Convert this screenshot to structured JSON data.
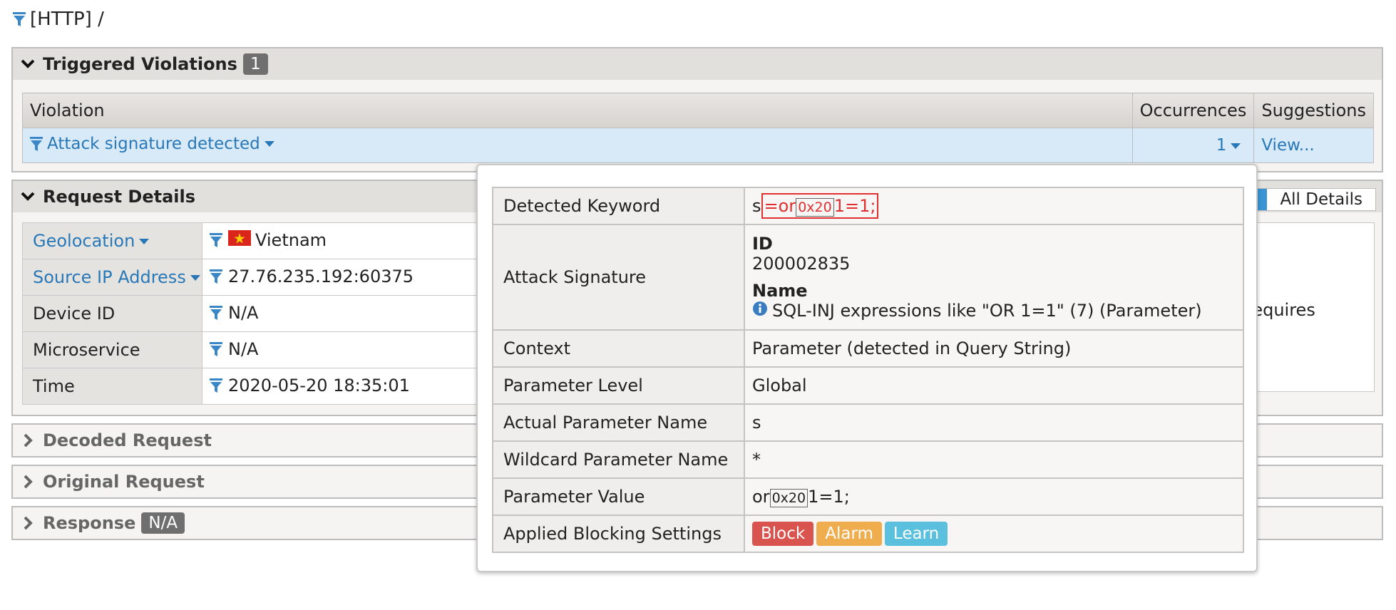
{
  "breadcrumb": {
    "text": "[HTTP] /"
  },
  "violations": {
    "title": "Triggered Violations",
    "count": "1",
    "headers": {
      "violation": "Violation",
      "occurrences": "Occurrences",
      "suggestions": "Suggestions"
    },
    "row": {
      "name": "Attack signature detected",
      "occurrences": "1",
      "suggestion": "View..."
    }
  },
  "request_details": {
    "title": "Request Details",
    "all_details_label": "All Details",
    "partial_text": "requires",
    "rows": [
      {
        "key": "Geolocation",
        "value": "Vietnam"
      },
      {
        "key": "Source IP Address",
        "value": "27.76.235.192:60375"
      },
      {
        "key": "Device ID",
        "value": "N/A"
      },
      {
        "key": "Microservice",
        "value": "N/A"
      },
      {
        "key": "Time",
        "value": "2020-05-20 18:35:01"
      }
    ]
  },
  "collapsed_sections": {
    "decoded": "Decoded Request",
    "original": "Original Request",
    "response": "Response",
    "response_badge": "N/A"
  },
  "popup": {
    "detected_keyword": {
      "label": "Detected Keyword",
      "prefix": "s",
      "hl_a": "=or",
      "hl_hex": "0x20",
      "hl_b": "1=1;"
    },
    "attack_signature": {
      "label": "Attack Signature",
      "id_label": "ID",
      "id": "200002835",
      "name_label": "Name",
      "name": "SQL-INJ expressions like \"OR 1=1\" (7) (Parameter)"
    },
    "context": {
      "label": "Context",
      "value": "Parameter (detected in Query String)"
    },
    "parameter_level": {
      "label": "Parameter Level",
      "value": "Global"
    },
    "actual_param": {
      "label": "Actual Parameter Name",
      "value": "s"
    },
    "wildcard_param": {
      "label": "Wildcard Parameter Name",
      "value": "*"
    },
    "param_value": {
      "label": "Parameter Value",
      "a": "or",
      "hex": "0x20",
      "b": "1=1;"
    },
    "blocking": {
      "label": "Applied Blocking Settings",
      "block": "Block",
      "alarm": "Alarm",
      "learn": "Learn"
    }
  },
  "colors": {
    "link": "#2878b8",
    "highlight": "#e03030",
    "block": "#d9534f",
    "alarm": "#f0ad4e",
    "learn": "#5bc0de",
    "row_highlight": "#d8eaf8"
  },
  "icons": [
    "filter-icon",
    "chevron-down-icon",
    "chevron-right-icon",
    "caret-down-icon",
    "vietnam-flag-icon",
    "info-icon"
  ]
}
